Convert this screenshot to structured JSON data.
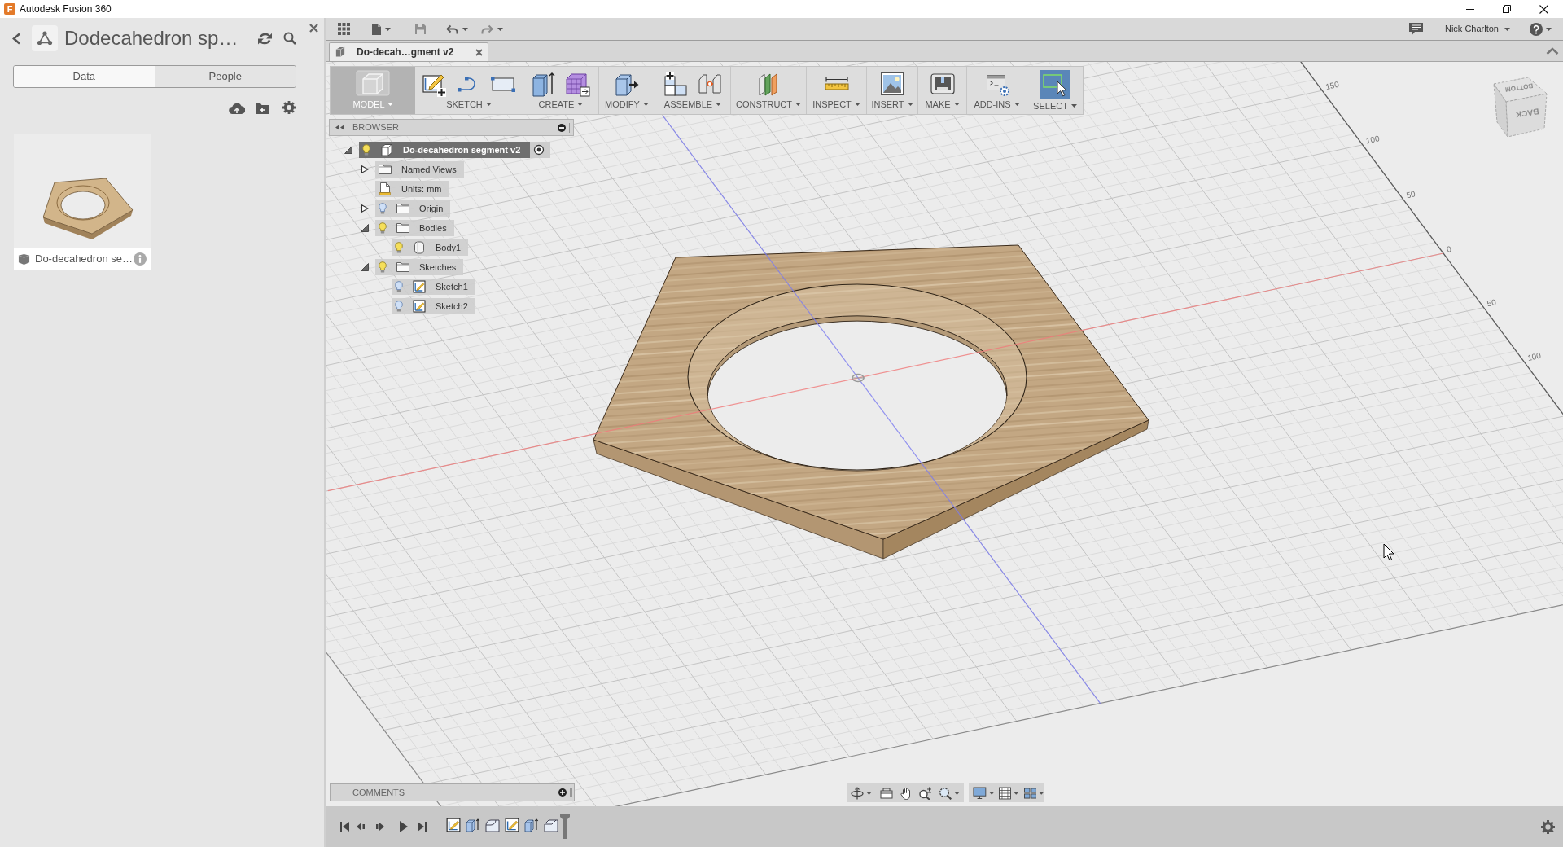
{
  "window": {
    "logo": "F",
    "title": "Autodesk Fusion 360"
  },
  "data_panel": {
    "title": "Dodecahedron sp…",
    "tabs": [
      {
        "label": "Data",
        "selected": true
      },
      {
        "label": "People",
        "selected": false
      }
    ],
    "files": [
      {
        "name": "Do-decahedron se…"
      }
    ]
  },
  "app_bar": {
    "user": "Nick Charlton"
  },
  "document_tabs": [
    {
      "label": "Do-decah…gment v2",
      "selected": true
    }
  ],
  "toolbar": [
    {
      "label": "MODEL",
      "kind": "model"
    },
    {
      "label": "SKETCH",
      "kind": "sketch"
    },
    {
      "label": "CREATE",
      "kind": "create"
    },
    {
      "label": "MODIFY",
      "kind": "modify"
    },
    {
      "label": "ASSEMBLE",
      "kind": "assemble"
    },
    {
      "label": "CONSTRUCT",
      "kind": "construct"
    },
    {
      "label": "INSPECT",
      "kind": "inspect"
    },
    {
      "label": "INSERT",
      "kind": "insert"
    },
    {
      "label": "MAKE",
      "kind": "make"
    },
    {
      "label": "ADD-INS",
      "kind": "addins"
    },
    {
      "label": "SELECT",
      "kind": "select"
    }
  ],
  "browser": {
    "title": "BROWSER",
    "tree": [
      {
        "label": "Do-decahedron segment v2",
        "kind": "component",
        "expanded": true,
        "visible": true,
        "selected": true,
        "active": true,
        "children": [
          {
            "label": "Named Views",
            "kind": "folder",
            "expanded": false,
            "selected": false
          },
          {
            "label": "Units: mm",
            "kind": "units",
            "selected": false
          },
          {
            "label": "Origin",
            "kind": "folder",
            "expanded": false,
            "visible": false,
            "selected": false
          },
          {
            "label": "Bodies",
            "kind": "folder",
            "expanded": true,
            "visible": true,
            "selected": false,
            "children": [
              {
                "label": "Body1",
                "kind": "body",
                "visible": true,
                "selected": false
              }
            ]
          },
          {
            "label": "Sketches",
            "kind": "folder",
            "expanded": true,
            "visible": true,
            "selected": false,
            "children": [
              {
                "label": "Sketch1",
                "kind": "sketch",
                "visible": false,
                "selected": false
              },
              {
                "label": "Sketch2",
                "kind": "sketch",
                "visible": false,
                "selected": false
              }
            ]
          }
        ]
      }
    ]
  },
  "viewport": {
    "ruler_labels": [
      "150",
      "100",
      "50",
      "0",
      "50",
      "100"
    ],
    "view_cube": [
      "BOTTOM",
      "BACK"
    ]
  },
  "comments": {
    "title": "COMMENTS"
  },
  "timeline": [
    {
      "kind": "sketch"
    },
    {
      "kind": "extrude"
    },
    {
      "kind": "fillet"
    },
    {
      "kind": "sketch"
    },
    {
      "kind": "extrude"
    },
    {
      "kind": "chamfer"
    }
  ]
}
